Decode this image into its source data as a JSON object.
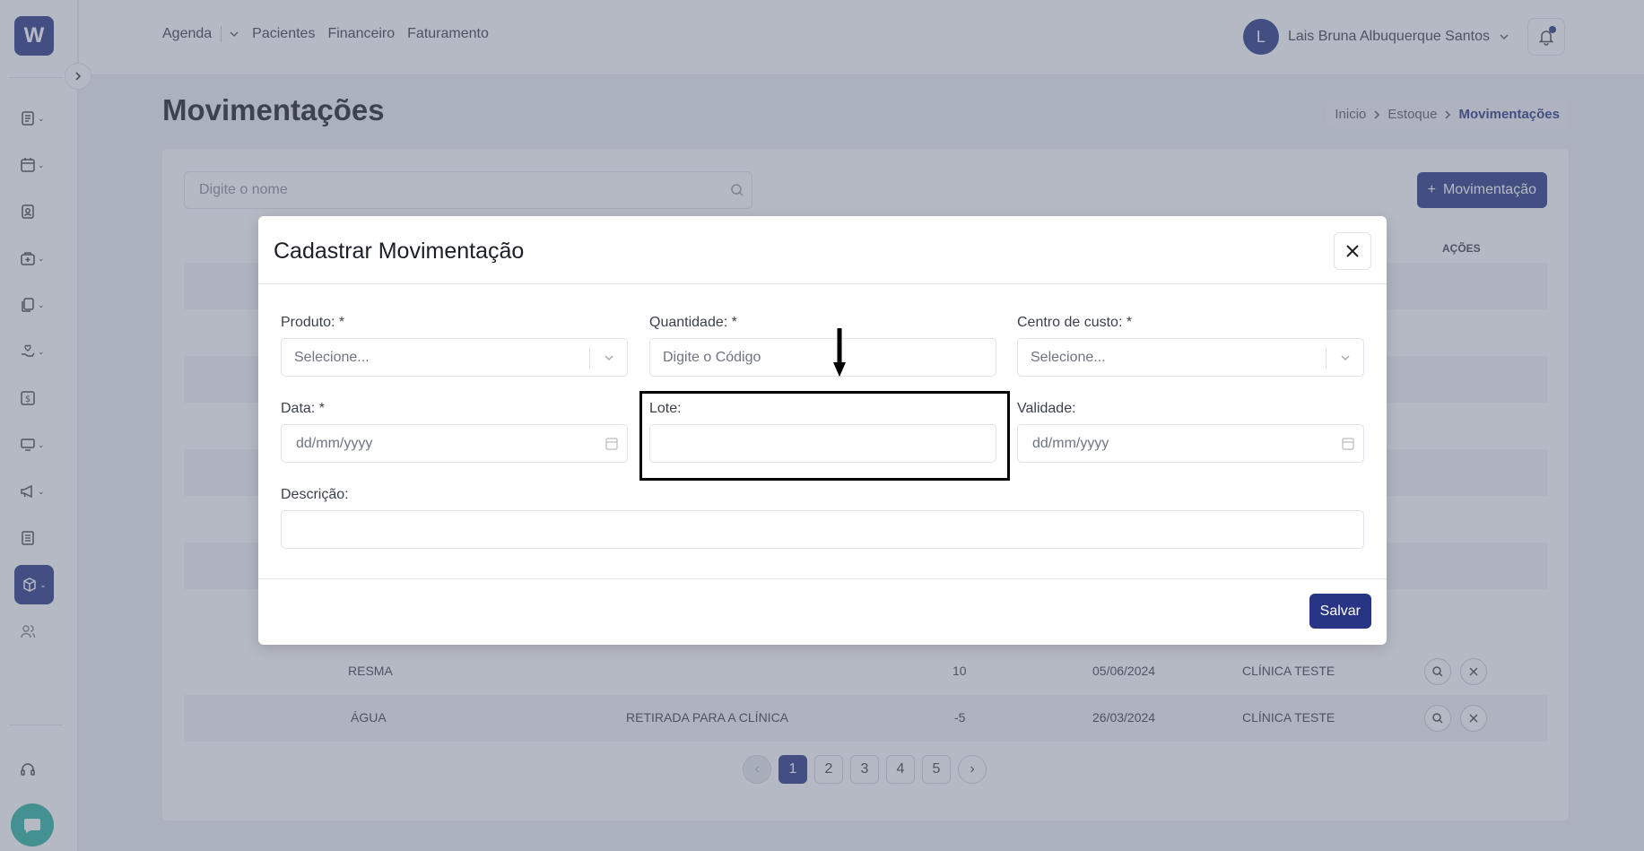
{
  "app": {
    "logo_letter": "W",
    "brand_color": "#283584"
  },
  "topnav": {
    "items": [
      "Agenda",
      "Pacientes",
      "Financeiro",
      "Faturamento"
    ],
    "user_initial": "L",
    "user_name": "Lais Bruna Albuquerque Santos"
  },
  "page": {
    "title": "Movimentações",
    "breadcrumb": [
      "Inicio",
      "Estoque",
      "Movimentações"
    ]
  },
  "list": {
    "search_placeholder": "Digite o nome",
    "add_button_label": "Movimentação",
    "actions_header": "AÇÕES",
    "visible_rows": [
      {
        "produto": "RESMA",
        "descricao": "",
        "quantidade": "10",
        "data": "05/06/2024",
        "centro": "CLÍNICA TESTE"
      },
      {
        "produto": "ÁGUA",
        "descricao": "RETIRADA PARA A CLÍNICA",
        "quantidade": "-5",
        "data": "26/03/2024",
        "centro": "CLÍNICA TESTE"
      }
    ],
    "pages": [
      "1",
      "2",
      "3",
      "4",
      "5"
    ],
    "current_page": "1"
  },
  "modal": {
    "title": "Cadastrar Movimentação",
    "fields": {
      "produto": {
        "label": "Produto: *",
        "placeholder": "Selecione..."
      },
      "quantidade": {
        "label": "Quantidade: *",
        "placeholder": "Digite o Código"
      },
      "centro_custo": {
        "label": "Centro de custo: *",
        "placeholder": "Selecione..."
      },
      "data": {
        "label": "Data: *",
        "placeholder": "dd/mm/yyyy"
      },
      "lote": {
        "label": "Lote:",
        "value": ""
      },
      "validade": {
        "label": "Validade:",
        "placeholder": "dd/mm/yyyy"
      },
      "descricao": {
        "label": "Descrição:",
        "value": ""
      }
    },
    "save_label": "Salvar"
  }
}
